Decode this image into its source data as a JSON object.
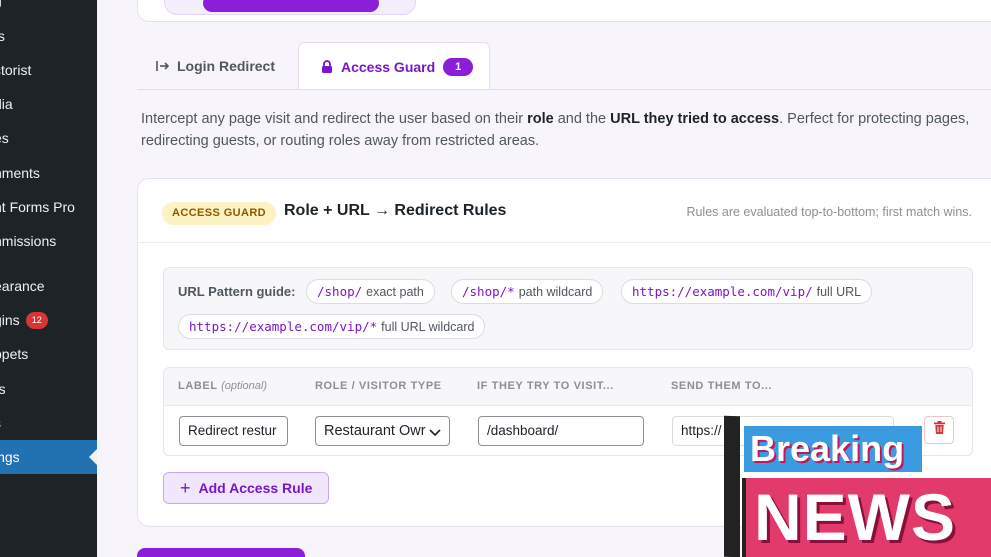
{
  "sidebar": {
    "items": [
      {
        "label": "ts"
      },
      {
        "label": "ctorist"
      },
      {
        "label": "dia"
      },
      {
        "label": "es"
      },
      {
        "label": "nments"
      },
      {
        "label": "nt Forms Pro"
      },
      {
        "label": "nmissions"
      },
      {
        "label": "earance"
      },
      {
        "label": "gins",
        "badge": "12"
      },
      {
        "label": "ppets"
      },
      {
        "label": "rs"
      },
      {
        "label": "s"
      },
      {
        "label": "ings"
      }
    ]
  },
  "tabs": [
    {
      "icon": "arrow-right-to-line-icon",
      "label": "Login Redirect"
    },
    {
      "icon": "lock-icon",
      "label": "Access Guard",
      "count": "1"
    }
  ],
  "intro": {
    "part1": "Intercept any page visit and redirect the user based on their ",
    "bold1": "role",
    "part2": " and the ",
    "bold2": "URL they tried to access",
    "part3": ". Perfect for protecting pages, redirecting guests, or routing roles away from restricted areas."
  },
  "card": {
    "badge": "ACCESS GUARD",
    "title": "Role + URL → Redirect Rules",
    "note": "Rules are evaluated top-to-bottom; first match wins."
  },
  "guide": {
    "label": "URL Pattern guide:",
    "chips": [
      {
        "code": "/shop/",
        "desc": "exact path"
      },
      {
        "code": "/shop/*",
        "desc": "path wildcard"
      },
      {
        "code": "https://example.com/vip/",
        "desc": "full URL"
      },
      {
        "code": "https://example.com/vip/*",
        "desc": "full URL wildcard"
      }
    ]
  },
  "rules": {
    "columns": {
      "label": "LABEL",
      "label_hint": "(optional)",
      "role": "ROLE / VISITOR TYPE",
      "visit": "IF THEY TRY TO VISIT...",
      "send": "SEND THEM TO..."
    },
    "row": {
      "label_value": "Redirect restur",
      "role_value": "Restaurant Owr",
      "visit_value": "/dashboard/",
      "send_value": "https://"
    }
  },
  "add_button": "Add Access Rule",
  "overlay": {
    "line1": "Breaking",
    "line2": "NEWS"
  },
  "colors": {
    "accent": "#8a1ed9",
    "sidebar_bg": "#1d2327",
    "sidebar_active": "#2271b1",
    "badge_bg": "#fdf2c4"
  }
}
